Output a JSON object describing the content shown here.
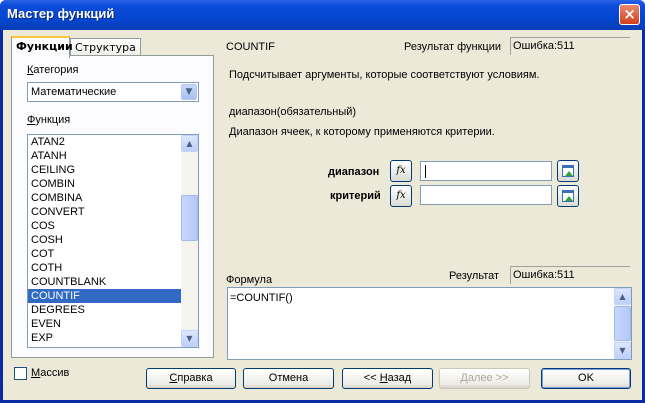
{
  "window": {
    "title": "Мастер функций",
    "close_icon": "×"
  },
  "tabs": [
    {
      "label": "Функции",
      "active": true
    },
    {
      "label": "Структура",
      "active": false
    }
  ],
  "category": {
    "label_first": "К",
    "label_rest": "атегория",
    "value": "Математические"
  },
  "function_list": {
    "label_first": "Ф",
    "label_rest": "ункция",
    "items": [
      "ATAN2",
      "ATANH",
      "CEILING",
      "COMBIN",
      "COMBINA",
      "CONVERT",
      "COS",
      "COSH",
      "COT",
      "COTH",
      "COUNTBLANK",
      "COUNTIF",
      "DEGREES",
      "EVEN",
      "EXP"
    ],
    "selected": "COUNTIF"
  },
  "details": {
    "function_name": "COUNTIF",
    "result_label": "Результат функции",
    "result_value": "Ошибка:511",
    "description": "Подсчитывает аргументы, которые соответствуют условиям.",
    "param_name": "диапазон(обязательный)",
    "param_description": "Диапазон ячеек, к которому применяются критерии."
  },
  "args": [
    {
      "label": "диапазон",
      "value": ""
    },
    {
      "label": "критерий",
      "value": ""
    }
  ],
  "formula": {
    "label": "Формула",
    "result_label": "Результат",
    "result_value": "Ошибка:511",
    "text": "=COUNTIF()"
  },
  "footer": {
    "array_first": "М",
    "array_rest": "ассив",
    "help_first": "С",
    "help_rest": "правка",
    "cancel": "Отмена",
    "back_prefix": "<< ",
    "back_first": "Н",
    "back_rest": "азад",
    "next_first": "Д",
    "next_rest": "алее >>",
    "ok": "OK"
  }
}
